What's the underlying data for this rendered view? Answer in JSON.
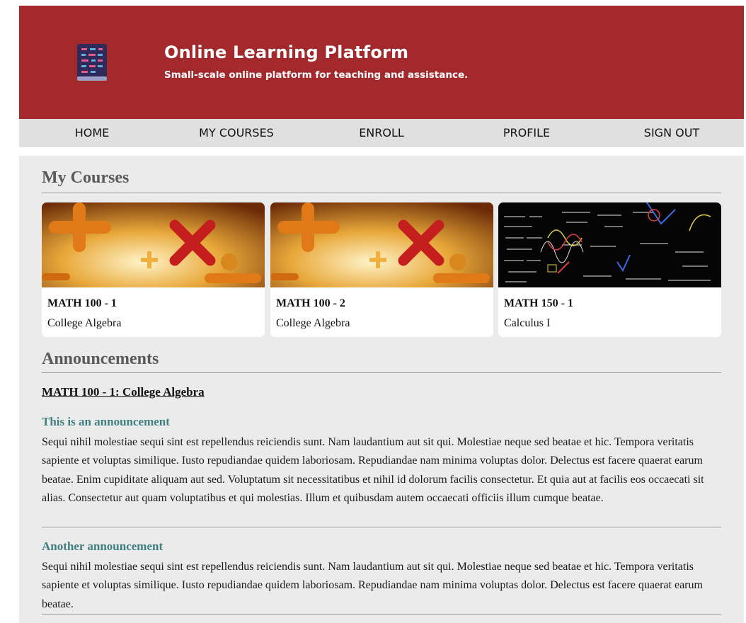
{
  "header": {
    "title": "Online Learning Platform",
    "subtitle": "Small-scale online platform for teaching and assistance."
  },
  "nav": [
    "HOME",
    "MY COURSES",
    "ENROLL",
    "PROFILE",
    "SIGN OUT"
  ],
  "courses_section": {
    "title": "My Courses",
    "courses": [
      {
        "code": "MATH 100 - 1",
        "name": "College Algebra",
        "image": "math-symbols-image"
      },
      {
        "code": "MATH 100 - 2",
        "name": "College Algebra",
        "image": "math-symbols-image"
      },
      {
        "code": "MATH 150 - 1",
        "name": "Calculus I",
        "image": "chalkboard-equations-image"
      }
    ]
  },
  "announcements_section": {
    "title": "Announcements",
    "course_link": "MATH 100 - 1: College Algebra",
    "items": [
      {
        "title": "This is an announcement",
        "body": "Sequi nihil molestiae sequi sint est repellendus reiciendis sunt. Nam laudantium aut sit qui. Molestiae neque sed beatae et hic. Tempora veritatis sapiente et voluptas similique. Iusto repudiandae quidem laboriosam. Repudiandae nam minima voluptas dolor. Delectus est facere quaerat earum beatae. Enim cupiditate aliquam aut sed. Voluptatum sit necessitatibus et nihil id dolorum facilis consectetur. Et quia aut at facilis eos occaecati sit alias. Consectetur aut quam voluptatibus et qui molestias. Illum et quibusdam autem occaecati officiis illum cumque beatae."
      },
      {
        "title": "Another announcement",
        "body": "Sequi nihil molestiae sequi sint est repellendus reiciendis sunt. Nam laudantium aut sit qui. Molestiae neque sed beatae et hic. Tempora veritatis sapiente et voluptas similique. Iusto repudiandae quidem laboriosam. Repudiandae nam minima voluptas dolor. Delectus est facere quaerat earum beatae."
      }
    ]
  },
  "colors": {
    "brand": "#a3292c",
    "nav_bg": "#e0e0e0",
    "main_bg": "#ebebeb",
    "announcement_title": "#3f7f80"
  },
  "icons": {
    "logo": "book-icon"
  }
}
